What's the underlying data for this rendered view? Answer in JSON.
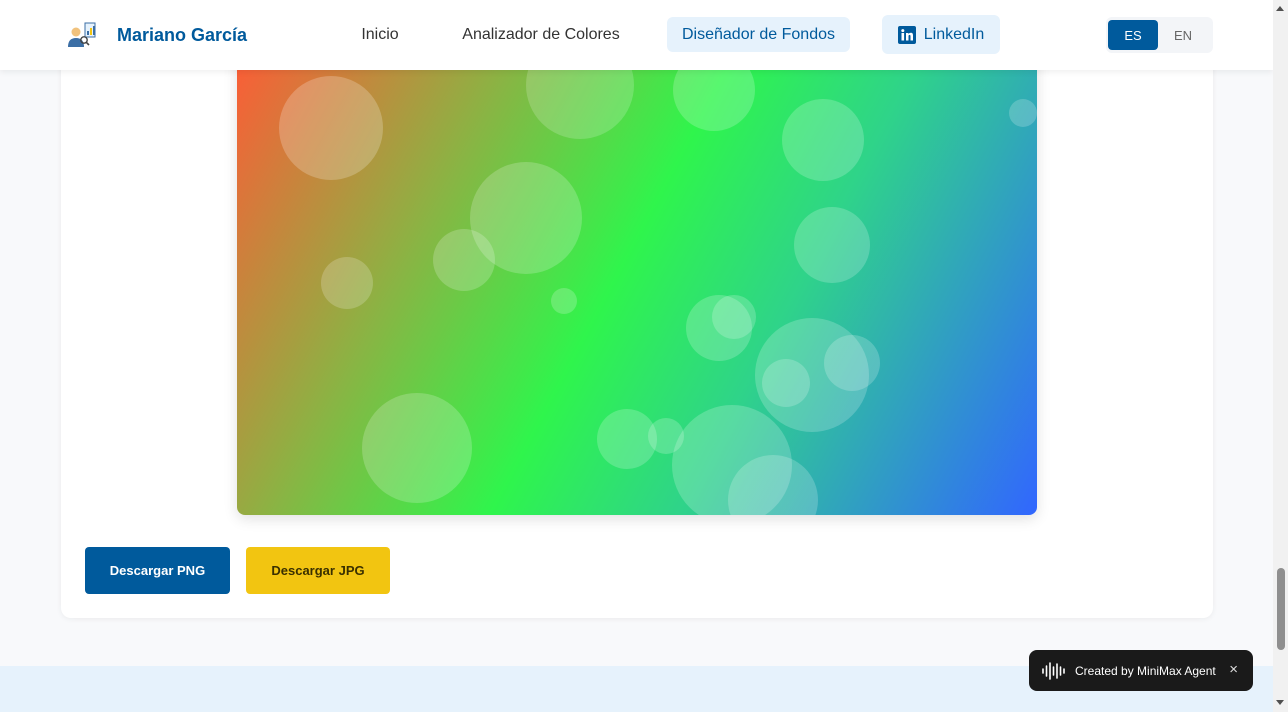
{
  "header": {
    "brand": "Mariano García",
    "logo_icon": "analyst-chart-icon",
    "nav": [
      {
        "label": "Inicio"
      },
      {
        "label": "Analizador de Colores"
      },
      {
        "label": "Diseñador de Fondos",
        "active": true
      },
      {
        "label": "LinkedIn",
        "icon": "linkedin-icon"
      }
    ],
    "lang": {
      "es": "ES",
      "en": "EN",
      "selected": "ES"
    }
  },
  "preview": {
    "gradient_colors": [
      "#ff5a36",
      "#8fb043",
      "#2ff54c",
      "#2fd38a",
      "#3166ff"
    ],
    "bubbles": "bokeh-circles"
  },
  "actions": {
    "png_label": "Descargar PNG",
    "jpg_label": "Descargar JPG"
  },
  "toast": {
    "text": "Created by MiniMax Agent",
    "close": "×",
    "icon": "waveform-icon"
  },
  "colors": {
    "primary": "#005a9c",
    "accent": "#f2c511",
    "nav_active_bg": "#e6f2fc"
  }
}
